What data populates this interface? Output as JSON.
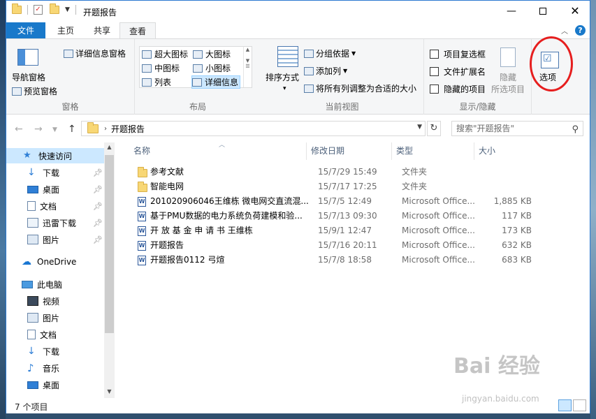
{
  "window": {
    "title": "开题报告"
  },
  "tabs": {
    "file": "文件",
    "home": "主页",
    "share": "共享",
    "view": "查看"
  },
  "ribbon": {
    "panes": {
      "nav_pane": "导航窗格",
      "preview_pane": "预览窗格",
      "details_pane": "详细信息窗格",
      "group_label": "窗格"
    },
    "layout": {
      "items": [
        "超大图标",
        "大图标",
        "中图标",
        "小图标",
        "列表",
        "详细信息"
      ],
      "selected": "详细信息",
      "group_label": "布局"
    },
    "current_view": {
      "sort_by": "排序方式",
      "group_by": "分组依据",
      "add_columns": "添加列",
      "size_all_columns": "将所有列调整为合适的大小",
      "group_label": "当前视图"
    },
    "show_hide": {
      "item_checkboxes": "项目复选框",
      "file_extensions": "文件扩展名",
      "hidden_items": "隐藏的项目",
      "hide": "隐藏",
      "selected_items": "所选项目",
      "group_label": "显示/隐藏"
    },
    "options": {
      "label": "选项"
    }
  },
  "address": {
    "path": "开题报告",
    "search_placeholder": "搜索\"开题报告\""
  },
  "nav_pane": {
    "quick_access": "快速访问",
    "quick_items": [
      "下载",
      "桌面",
      "文档",
      "迅雷下载",
      "图片"
    ],
    "onedrive": "OneDrive",
    "this_pc": "此电脑",
    "pc_items": [
      "视频",
      "图片",
      "文档",
      "下载",
      "音乐",
      "桌面"
    ]
  },
  "columns": {
    "name": "名称",
    "date": "修改日期",
    "type": "类型",
    "size": "大小"
  },
  "files": [
    {
      "name": "参考文献",
      "date": "15/7/29 15:49",
      "type": "文件夹",
      "size": "",
      "kind": "folder"
    },
    {
      "name": "智能电网",
      "date": "15/7/17 17:25",
      "type": "文件夹",
      "size": "",
      "kind": "folder"
    },
    {
      "name": "201020906046王维栋 微电网交直流混...",
      "date": "15/7/5 12:49",
      "type": "Microsoft Office...",
      "size": "1,885 KB",
      "kind": "doc"
    },
    {
      "name": "基于PMU数据的电力系统负荷建模和验...",
      "date": "15/7/13 09:30",
      "type": "Microsoft Office...",
      "size": "117 KB",
      "kind": "doc"
    },
    {
      "name": "开 放 基 金 申 请 书  王维栋",
      "date": "15/9/1 12:47",
      "type": "Microsoft Office...",
      "size": "173 KB",
      "kind": "doc"
    },
    {
      "name": "开题报告",
      "date": "15/7/16 20:11",
      "type": "Microsoft Office...",
      "size": "632 KB",
      "kind": "doc"
    },
    {
      "name": "开题报告0112 弓煊",
      "date": "15/7/8 18:58",
      "type": "Microsoft Office...",
      "size": "683 KB",
      "kind": "doc"
    }
  ],
  "status": {
    "item_count": "7 个项目"
  },
  "watermark": {
    "brand": "Bai 经验",
    "url": "jingyan.baidu.com"
  }
}
